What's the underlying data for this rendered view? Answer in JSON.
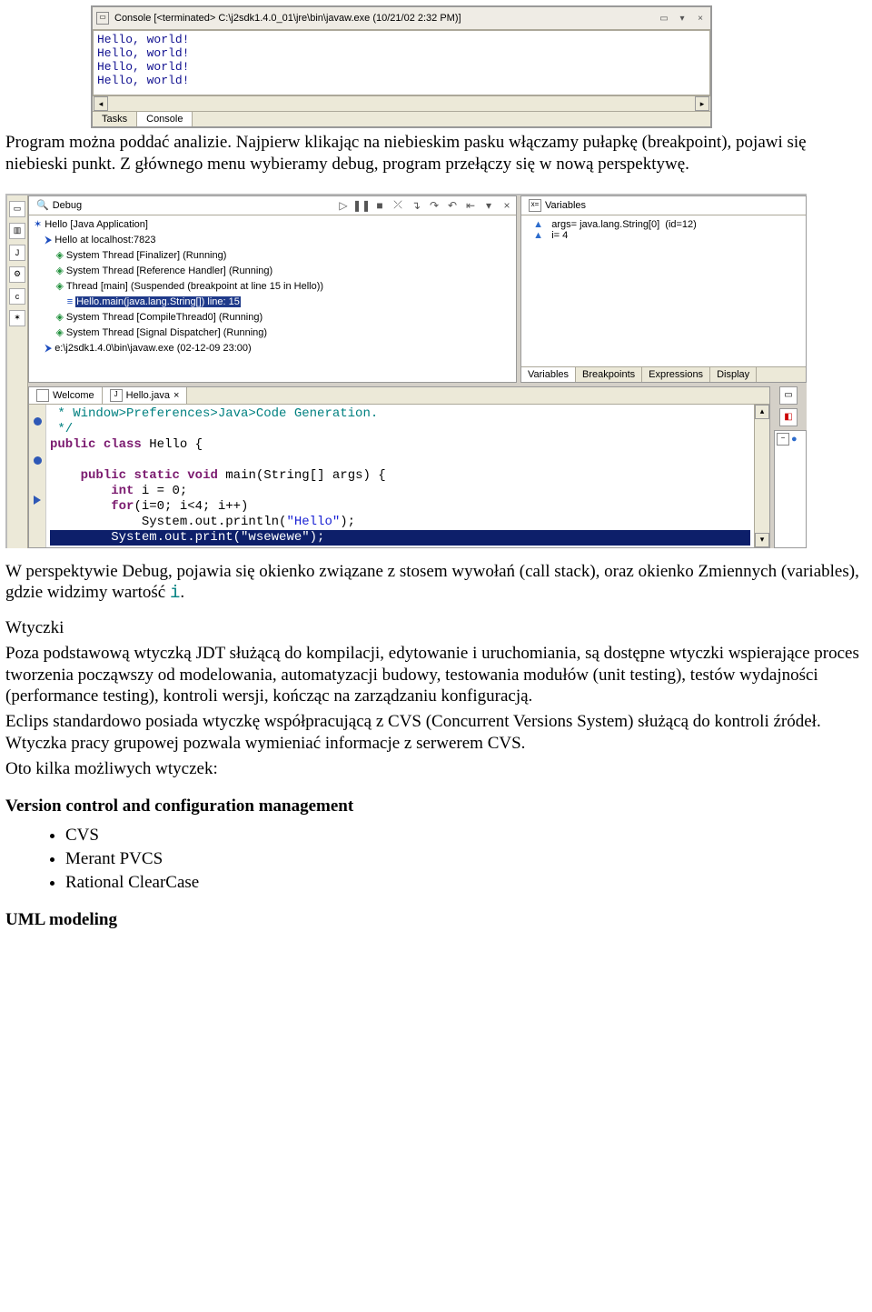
{
  "console": {
    "title": "Console [<terminated> C:\\j2sdk1.4.0_01\\jre\\bin\\javaw.exe (10/21/02 2:32 PM)]",
    "lines": [
      "Hello, world!",
      "Hello, world!",
      "Hello, world!",
      "Hello, world!"
    ],
    "tabs": [
      "Tasks",
      "Console"
    ]
  },
  "paragraph1": "Program można poddać analizie. Najpierw klikając na niebieskim pasku włączamy pułapkę (breakpoint), pojawi się niebieski punkt. Z głównego menu wybieramy debug, program przełączy się w nową perspektywę.",
  "debug": {
    "viewTitle": "Debug",
    "tree": [
      {
        "indent": 0,
        "cls": "icon-app",
        "text": "Hello [Java Application]"
      },
      {
        "indent": 1,
        "cls": "icon-host",
        "text": "Hello at localhost:7823"
      },
      {
        "indent": 2,
        "cls": "icon-thread",
        "text": "System Thread [Finalizer] (Running)"
      },
      {
        "indent": 2,
        "cls": "icon-thread",
        "text": "System Thread [Reference Handler] (Running)"
      },
      {
        "indent": 2,
        "cls": "icon-thread",
        "text": "Thread [main] (Suspended (breakpoint at line 15 in Hello))"
      },
      {
        "indent": 3,
        "cls": "icon-frame",
        "text": "Hello.main(java.lang.String[]) line: 15",
        "selected": true
      },
      {
        "indent": 2,
        "cls": "icon-thread",
        "text": "System Thread [CompileThread0] (Running)"
      },
      {
        "indent": 2,
        "cls": "icon-thread",
        "text": "System Thread [Signal Dispatcher] (Running)"
      },
      {
        "indent": 1,
        "cls": "icon-host",
        "text": "e:\\j2sdk1.4.0\\bin\\javaw.exe (02-12-09 23:00)"
      }
    ],
    "varsTitle": "Variables",
    "vars": [
      {
        "name": "args",
        "value": "java.lang.String[0]  (id=12)"
      },
      {
        "name": "i",
        "value": "4"
      }
    ],
    "varsTabs": [
      "Variables",
      "Breakpoints",
      "Expressions",
      "Display"
    ]
  },
  "editor": {
    "tabs": [
      "Welcome",
      "Hello.java"
    ],
    "activeClose": "×",
    "code": {
      "l1": " * Window>Preferences>Java>Code Generation.",
      "l2": " */",
      "l3_kw1": "public",
      "l3_kw2": "class",
      "l3_name": " Hello {",
      "l4_kw1": "public",
      "l4_kw2": "static",
      "l4_kw3": "void",
      "l4_rest": " main(String[] args) {",
      "l5_kw": "int",
      "l5_rest": " i = 0;",
      "l6_kw": "for",
      "l6_rest": "(i=0; i<4; i++)",
      "l7a": "System.out.println(",
      "l7s": "\"Hello\"",
      "l7b": ");",
      "l8": "        System.out.print(\"wsewewe\");"
    }
  },
  "paragraph2a": "W perspektywie Debug, pojawia się okienko związane z stosem wywołań (call stack), oraz okienko Zmiennych (variables), gdzie widzimy wartość ",
  "paragraph2i": "i",
  "paragraph2b": ".",
  "pluginsHeading": "Wtyczki",
  "plugins1": "Poza podstawową wtyczką JDT służącą do kompilacji, edytowanie i uruchomiania, są dostępne wtyczki wspierające proces tworzenia począwszy od modelowania, automatyzacji budowy, testowania modułów (unit testing), testów wydajności (performance testing), kontroli wersji, kończąc na zarządzaniu konfiguracją.",
  "plugins2": "Eclips standardowo posiada wtyczkę współpracującą z CVS (Concurrent Versions System) służącą do kontroli źródeł. Wtyczka pracy grupowej pozwala wymieniać informacje z serwerem CVS.",
  "plugins3": "Oto kilka możliwych wtyczek:",
  "vcHeading": "Version control and configuration management",
  "vcList": [
    "CVS",
    "Merant PVCS",
    "Rational ClearCase"
  ],
  "umlHeading": "UML modeling"
}
